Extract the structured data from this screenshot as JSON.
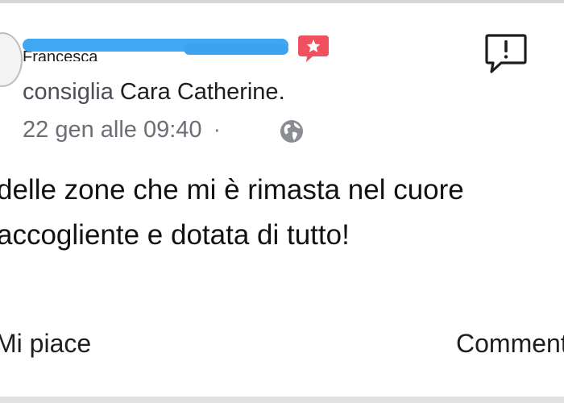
{
  "post": {
    "author_name_redacted": "Francesca",
    "recommend_verb": "consiglia",
    "page_name": "Cara Catherine.",
    "timestamp": "22 gen alle 09:40",
    "separator": "·",
    "privacy_icon": "globe-icon",
    "recommend_badge_icon": "star-badge-icon",
    "report_icon": "report-icon",
    "text_line_1": "delle zone che mi è rimasta nel cuore",
    "text_line_2": "accogliente e dotata di tutto!"
  },
  "actions": {
    "left_label": "Mi piace",
    "right_label": "Commenta"
  },
  "colors": {
    "redaction": "#3fa8f5",
    "badge": "#f0515e",
    "text": "#1c1e21",
    "meta": "#6b6f75"
  }
}
